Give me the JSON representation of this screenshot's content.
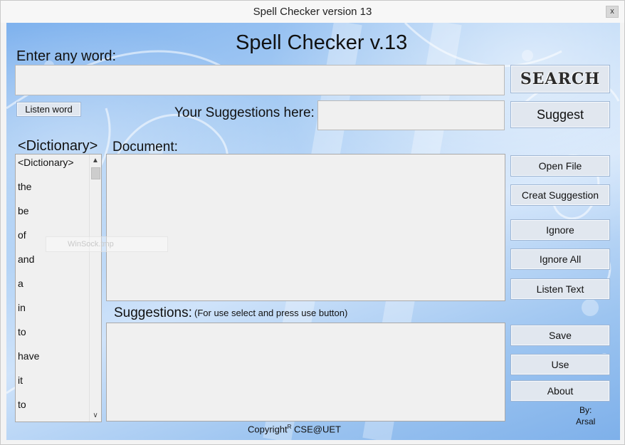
{
  "window": {
    "title": "Spell Checker version 13",
    "close_label": "x"
  },
  "header": {
    "app_title": "Spell Checker v.13"
  },
  "input": {
    "enter_label": "Enter any word:",
    "value": ""
  },
  "buttons": {
    "search": "SEARCH",
    "listen_word": "Listen word",
    "suggest": "Suggest",
    "open_file": "Open File",
    "creat_suggestion": "Creat Suggestion",
    "ignore": "Ignore",
    "ignore_all": "Ignore All",
    "listen_text": "Listen Text",
    "save": "Save",
    "use": "Use",
    "about": "About"
  },
  "suggestion_input": {
    "label": "Your Suggestions here:",
    "value": ""
  },
  "dictionary": {
    "heading": "<Dictionary>",
    "items": [
      "<Dictionary>",
      "the",
      "be",
      "of",
      "and",
      "a",
      "in",
      "to",
      "have",
      "it",
      "to"
    ]
  },
  "document": {
    "label": "Document:",
    "background_text": "WinSock.tmp"
  },
  "suggestions": {
    "label": "Suggestions:",
    "note": "(For use select and press use button)"
  },
  "footer": {
    "copyright": "Copyright",
    "copyright_mark": "R",
    "org": "CSE@UET",
    "by_label": "By:",
    "author": "Arsal"
  }
}
